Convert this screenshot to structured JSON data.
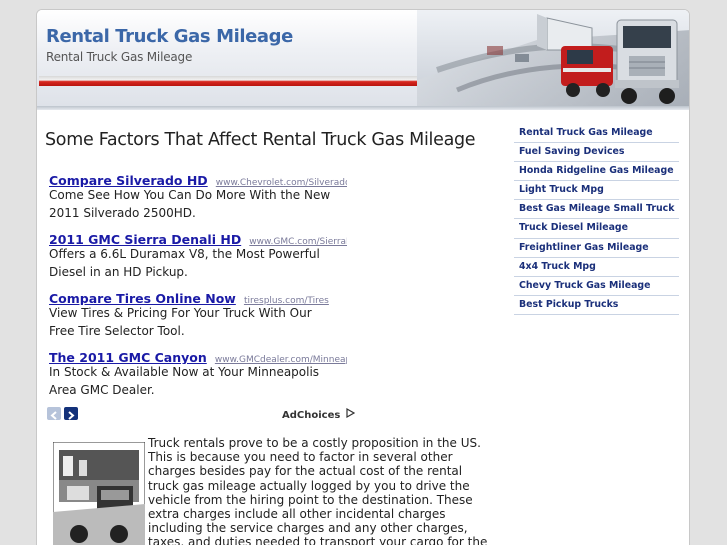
{
  "header": {
    "site_title": "Rental Truck Gas Mileage",
    "site_tagline": "Rental Truck Gas Mileage"
  },
  "main": {
    "heading": "Some Factors That Affect Rental Truck Gas Mileage"
  },
  "ads": [
    {
      "title": "Compare Silverado HD",
      "url": "www.Chevrolet.com/SilveradoHD",
      "desc": "Come See How You Can Do More With the New 2011 Silverado 2500HD."
    },
    {
      "title": "2011 GMC Sierra Denali HD",
      "url": "www.GMC.com/SierraDenaliHD",
      "desc": "Offers a 6.6L Duramax V8, the Most Powerful Diesel in an HD Pickup."
    },
    {
      "title": "Compare Tires Online Now",
      "url": "tiresplus.com/Tires",
      "desc": "View Tires & Pricing For Your Truck With Our Free Tire Selector Tool."
    },
    {
      "title": "The 2011 GMC Canyon",
      "url": "www.GMCdealer.com/Minneapolis",
      "desc": "In Stock & Available Now at Your Minneapolis Area GMC Dealer."
    }
  ],
  "ad_controls": {
    "adchoices_label": "AdChoices"
  },
  "article": {
    "text": "Truck rentals prove to be a costly proposition in the US. This is because you need to factor in several other charges besides pay for the actual cost of the rental truck gas mileage actually logged by you to drive the vehicle from the hiring point to the destination. These extra charges include all other incidental charges including the service charges and any other charges, taxes, and duties needed to transport your cargo for the agreed period of hire."
  },
  "sidebar": {
    "items": [
      {
        "label": "Rental Truck Gas Mileage"
      },
      {
        "label": "Fuel Saving Devices"
      },
      {
        "label": "Honda Ridgeline Gas Mileage"
      },
      {
        "label": "Light Truck Mpg"
      },
      {
        "label": "Best Gas Mileage Small Truck"
      },
      {
        "label": "Truck Diesel Mileage"
      },
      {
        "label": "Freightliner Gas Mileage"
      },
      {
        "label": "4x4 Truck Mpg"
      },
      {
        "label": "Chevy Truck Gas Mileage"
      },
      {
        "label": "Best Pickup Trucks"
      }
    ]
  },
  "colors": {
    "link": "#1a1aa6",
    "title": "#3b67a8",
    "sidebar_link": "#1a2f7a",
    "header_stripe": "#d9281f"
  }
}
